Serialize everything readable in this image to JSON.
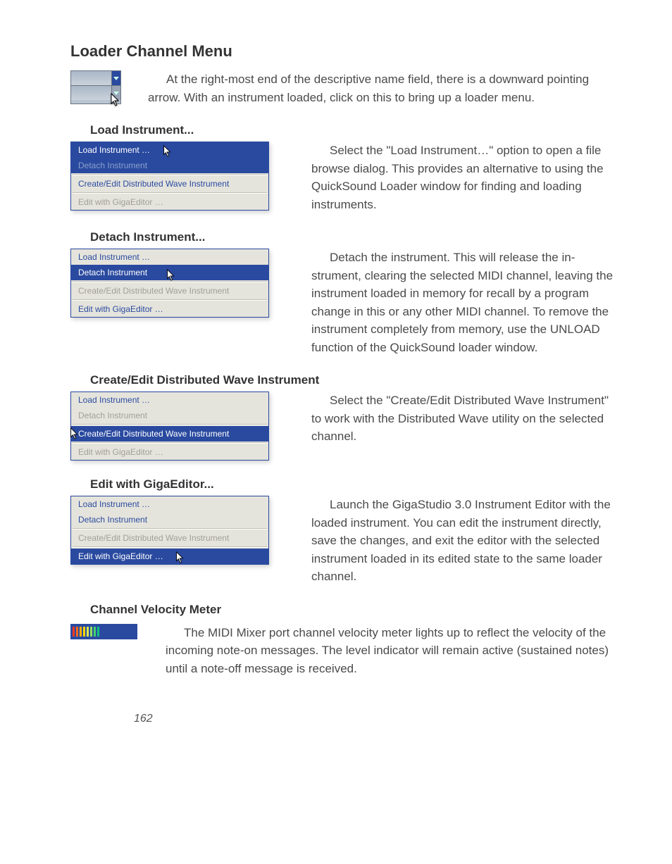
{
  "title": "Loader Channel Menu",
  "intro": "At the right-most end of the descriptive name field, there is a down­ward pointing arrow. With an instrument loaded, click on this to bring up a loader menu.",
  "sections": {
    "load": {
      "heading": "Load Instrument...",
      "menu": {
        "item1": "Load Instrument …",
        "item2": "Detach Instrument",
        "item3": "Create/Edit Distributed Wave Instrument",
        "item4": "Edit with GigaEditor …"
      },
      "text": "Select the \"Load Instrument…\" option to open a file browse dialog. This provides an alternative to using the QuickSound Loader window for finding and loading instruments."
    },
    "detach": {
      "heading": "Detach Instrument...",
      "menu": {
        "item1": "Load Instrument …",
        "item2": "Detach Instrument",
        "item3": "Create/Edit Distributed Wave Instrument",
        "item4": "Edit with GigaEditor …"
      },
      "text": "Detach the instrument. This will release the in­strument, clearing the selected MIDI channel, leav­ing the instrument loaded in memory for recall by a program change in this or any other MIDI channel. To remove the instrument completely from mem­ory, use the UNLOAD function of the QuickSound loader window."
    },
    "createedit": {
      "heading": "Create/Edit Distributed Wave Instrument",
      "menu": {
        "item1": "Load Instrument …",
        "item2": "Detach Instrument",
        "item3": "Create/Edit Distributed Wave Instrument",
        "item4": "Edit with GigaEditor …"
      },
      "text": "Select the \"Create/Edit Distributed Wave Instru­ment\" to work with the Distributed Wave utility on the selected channel."
    },
    "giga": {
      "heading": "Edit with GigaEditor...",
      "menu": {
        "item1": "Load Instrument …",
        "item2": "Detach Instrument",
        "item3": "Create/Edit Distributed Wave Instrument",
        "item4": "Edit with GigaEditor …"
      },
      "text": "Launch the GigaStudio 3.0 Instrument Editor with the loaded instrument. You can edit the in­strument directly, save the changes, and exit the editor with the selected instrument loaded in its edited state to the same loader channel."
    },
    "velocity": {
      "heading": "Channel Velocity Meter",
      "text": "The MIDI Mixer port channel velocity meter lights up to reflect the velocity of the incoming note-on messages. The level indi­cator will remain active (sustained notes) until a note-off message is received."
    }
  },
  "pageNumber": "162"
}
